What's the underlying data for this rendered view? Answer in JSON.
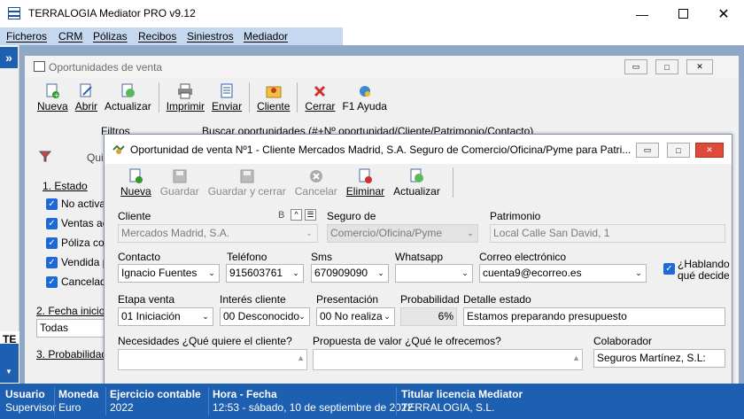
{
  "app": {
    "title": "TERRALOGIA Mediator PRO v9.12"
  },
  "menu": [
    "Ficheros",
    "CRM",
    "Pólizas",
    "Recibos",
    "Siniestros",
    "Mediador"
  ],
  "left_label": "TE",
  "back_window": {
    "title": "Oportunidades de venta",
    "toolbar": [
      "Nueva",
      "Abrir",
      "Actualizar",
      "Imprimir",
      "Enviar",
      "Cliente",
      "Cerrar",
      "F1 Ayuda"
    ],
    "filtros_label": "Filtros",
    "search_text": "Buscar oportunidades (#+Nº oportunidad/Cliente/Patrimonio/Contacto)",
    "quick_label": "Qui",
    "estado_header": "1. Estado",
    "estado_items": [
      "No activas",
      "Ventas ac",
      "Póliza con",
      "Vendida p",
      "Cancelada"
    ],
    "fecha_header": "2. Fecha inicio",
    "fecha_value": "Todas",
    "prob_header": "3. Probabilidad d"
  },
  "front_window": {
    "title": "Oportunidad de venta Nº1 - Cliente Mercados Madrid, S.A. Seguro de Comercio/Oficina/Pyme para Patri...",
    "toolbar": [
      "Nueva",
      "Guardar",
      "Guardar y cerrar",
      "Cancelar",
      "Eliminar",
      "Actualizar"
    ],
    "cliente_label": "Cliente",
    "cliente_btn_b": "B",
    "cliente_btn_up": "^",
    "cliente_value": "Mercados Madrid, S.A.",
    "seguro_label": "Seguro de",
    "seguro_value": "Comercio/Oficina/Pyme",
    "patrimonio_label": "Patrimonio",
    "patrimonio_value": "Local Calle San David, 1",
    "contacto_label": "Contacto",
    "contacto_value": "Ignacio Fuentes",
    "telefono_label": "Teléfono",
    "telefono_value": "915603761",
    "sms_label": "Sms",
    "sms_value": "670909090",
    "whatsapp_label": "Whatsapp",
    "whatsapp_value": "",
    "correo_label": "Correo electrónico",
    "correo_value": "cuenta9@ecorreo.es",
    "hablando_line1": "¿Hablando",
    "hablando_line2": "qué decide",
    "etapa_label": "Etapa venta",
    "etapa_value": "01 Iniciación",
    "interes_label": "Interés cliente",
    "interes_value": "00 Desconocido",
    "presentacion_label": "Presentación",
    "presentacion_value": "00 No realiza",
    "probabilidad_label": "Probabilidad",
    "probabilidad_value": "6%",
    "detalle_label": "Detalle estado",
    "detalle_value": "Estamos preparando presupuesto",
    "necesidades_label": "Necesidades ¿Qué quiere el cliente?",
    "propuesta_label": "Propuesta de valor ¿Qué le ofrecemos?",
    "colaborador_label": "Colaborador",
    "colaborador_value": "Seguros Martínez, S.L:"
  },
  "status": {
    "usuario_h": "Usuario",
    "usuario_v": "Supervisor",
    "moneda_h": "Moneda",
    "moneda_v": "Euro",
    "ejercicio_h": "Ejercicio contable",
    "ejercicio_v": "2022",
    "hora_h": "Hora - Fecha",
    "hora_v": "12:53 - sábado, 10 de septiembre de 2022",
    "titular_h": "Titular licencia Mediator",
    "titular_v": "TERRALOGIA, S.L."
  },
  "colors": {
    "accent": "#1d5fb0",
    "menu_highlight": "#c6d7f0",
    "workspace": "#8fa8c8"
  }
}
